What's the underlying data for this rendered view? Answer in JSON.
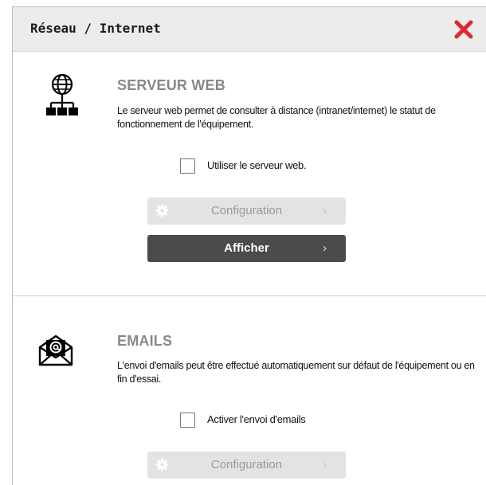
{
  "dialog": {
    "title": "Réseau / Internet",
    "close_icon": "close-x-icon",
    "close_color": "#e0262e"
  },
  "web_server": {
    "icon": "network-globe-icon",
    "title": "SERVEUR WEB",
    "description": "Le serveur web permet de consulter à distance (intranet/internet) le statut de fonctionnement de l'équipement.",
    "checkbox_label": "Utiliser le serveur web.",
    "checkbox_checked": false,
    "config_button_label": "Configuration",
    "config_button_enabled": false,
    "show_button_label": "Afficher"
  },
  "emails": {
    "icon": "email-envelope-icon",
    "title": "EMAILS",
    "description": "L'envoi d'emails peut être effectué automatiquement sur défaut de l'équipement ou en fin d'essai.",
    "checkbox_label": "Activer l'envoi d'emails",
    "checkbox_checked": false,
    "config_button_label": "Configuration",
    "config_button_enabled": false
  }
}
